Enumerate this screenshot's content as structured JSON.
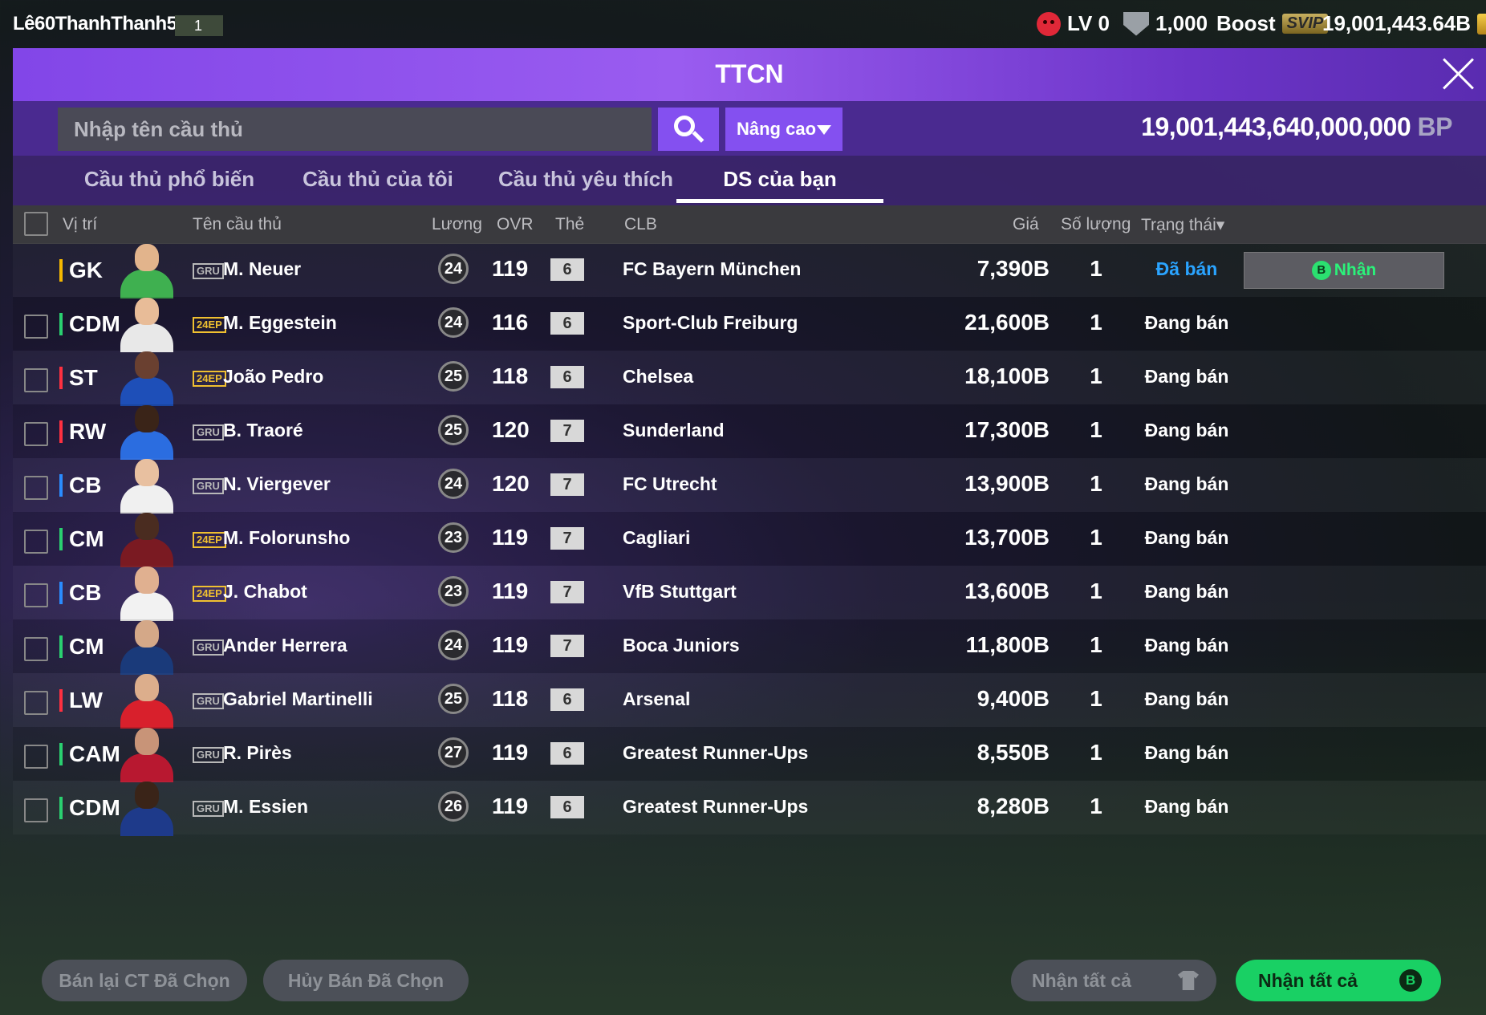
{
  "topbar": {
    "username": "Lê60ThanhThanh50",
    "user_level": "1",
    "lv_label": "LV 0",
    "coin_amount": "1,000",
    "boost_label": "Boost",
    "svip_label": "SVIP",
    "money": "19,001,443.64B"
  },
  "header": {
    "title": "TTCN"
  },
  "search": {
    "placeholder": "Nhập tên cầu thủ",
    "advanced_label": "Nâng cao",
    "bp_amount": "19,001,443,640,000,000",
    "bp_unit": "BP"
  },
  "tabs": [
    {
      "label": "Cầu thủ phổ biến",
      "active": false
    },
    {
      "label": "Cầu thủ của tôi",
      "active": false
    },
    {
      "label": "Cầu thủ yêu thích",
      "active": false
    },
    {
      "label": "DS của bạn",
      "active": true
    }
  ],
  "columns": {
    "position": "Vị trí",
    "name": "Tên cầu thủ",
    "wage": "Lương",
    "ovr": "OVR",
    "upgrade": "Thẻ",
    "club": "CLB",
    "price": "Giá",
    "qty": "Số lượng",
    "status": "Trạng thái▾"
  },
  "claim_label": "Nhận",
  "rows": [
    {
      "pos": "GK",
      "card": "GRU",
      "name": "M. Neuer",
      "wage": "24",
      "ovr": "119",
      "upgrade": "6",
      "club": "FC Bayern München",
      "price": "7,390B",
      "qty": "1",
      "status": "Đã bán",
      "sold": true
    },
    {
      "pos": "CDM",
      "card": "24EP",
      "name": "M. Eggestein",
      "wage": "24",
      "ovr": "116",
      "upgrade": "6",
      "club": "Sport-Club Freiburg",
      "price": "21,600B",
      "qty": "1",
      "status": "Đang bán"
    },
    {
      "pos": "ST",
      "card": "24EP",
      "name": "João Pedro",
      "wage": "25",
      "ovr": "118",
      "upgrade": "6",
      "club": "Chelsea",
      "price": "18,100B",
      "qty": "1",
      "status": "Đang bán"
    },
    {
      "pos": "RW",
      "card": "GRU",
      "name": "B. Traoré",
      "wage": "25",
      "ovr": "120",
      "upgrade": "7",
      "club": "Sunderland",
      "price": "17,300B",
      "qty": "1",
      "status": "Đang bán"
    },
    {
      "pos": "CB",
      "card": "GRU",
      "name": "N. Viergever",
      "wage": "24",
      "ovr": "120",
      "upgrade": "7",
      "club": "FC Utrecht",
      "price": "13,900B",
      "qty": "1",
      "status": "Đang bán"
    },
    {
      "pos": "CM",
      "card": "24EP",
      "name": "M. Folorunsho",
      "wage": "23",
      "ovr": "119",
      "upgrade": "7",
      "club": "Cagliari",
      "price": "13,700B",
      "qty": "1",
      "status": "Đang bán"
    },
    {
      "pos": "CB",
      "card": "24EP",
      "name": "J. Chabot",
      "wage": "23",
      "ovr": "119",
      "upgrade": "7",
      "club": "VfB Stuttgart",
      "price": "13,600B",
      "qty": "1",
      "status": "Đang bán"
    },
    {
      "pos": "CM",
      "card": "GRU",
      "name": "Ander Herrera",
      "wage": "24",
      "ovr": "119",
      "upgrade": "7",
      "club": "Boca Juniors",
      "price": "11,800B",
      "qty": "1",
      "status": "Đang bán"
    },
    {
      "pos": "LW",
      "card": "GRU",
      "name": "Gabriel Martinelli",
      "wage": "25",
      "ovr": "118",
      "upgrade": "6",
      "club": "Arsenal",
      "price": "9,400B",
      "qty": "1",
      "status": "Đang bán"
    },
    {
      "pos": "CAM",
      "card": "GRU",
      "name": "R. Pirès",
      "wage": "27",
      "ovr": "119",
      "upgrade": "6",
      "club": "Greatest Runner-Ups",
      "price": "8,550B",
      "qty": "1",
      "status": "Đang bán"
    },
    {
      "pos": "CDM",
      "card": "GRU",
      "name": "M. Essien",
      "wage": "26",
      "ovr": "119",
      "upgrade": "6",
      "club": "Greatest Runner-Ups",
      "price": "8,280B",
      "qty": "1",
      "status": "Đang bán"
    }
  ],
  "bottom": {
    "resell_label": "Bán lại CT Đã Chọn",
    "cancel_label": "Hủy Bán Đã Chọn",
    "claim_all_grey": "Nhận tất cả",
    "claim_all_green": "Nhận tất cả"
  },
  "colors": {
    "accent": "#8450f0",
    "header": "#9a5cf0",
    "sold_status": "#2aa4ff",
    "claim_green": "#19d064",
    "pos_gk": "#f5b800",
    "pos_def": "#2a8cff",
    "pos_mid": "#2ad070",
    "pos_att": "#ff3040"
  },
  "icons": [
    "red-face-icon",
    "shield-icon",
    "gold-coin-icon",
    "close-icon",
    "search-icon",
    "dropdown-arrow-icon",
    "b-coin-icon",
    "shirt-icon"
  ]
}
